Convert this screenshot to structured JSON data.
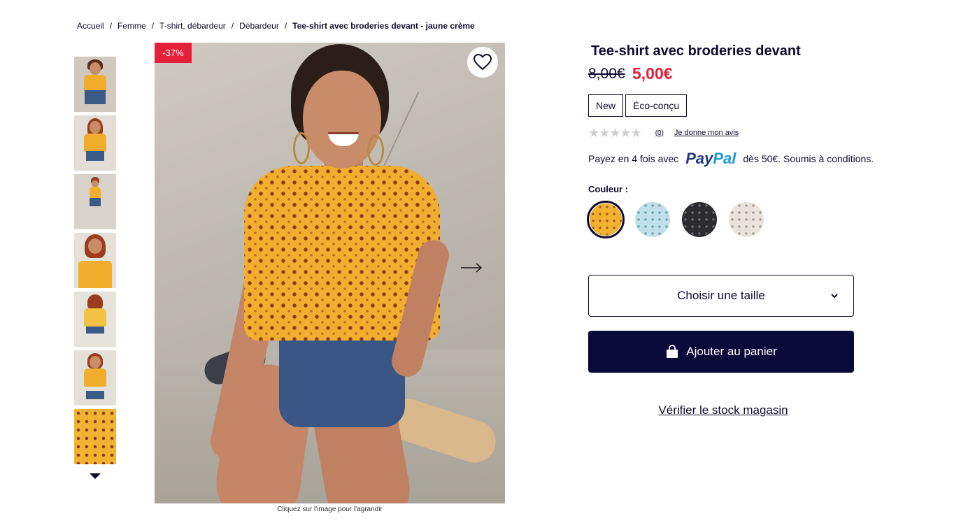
{
  "breadcrumb": {
    "items": [
      "Accueil",
      "Femme",
      "T-shirt, débardeur",
      "Débardeur"
    ],
    "separator": "/",
    "current": "Tee-shirt avec broderies devant - jaune crème"
  },
  "gallery": {
    "discount_badge": "-37%",
    "caption": "Cliquez sur l'image pour l'agrandir",
    "thumbnail_count": 7,
    "selected_thumbnail": 1
  },
  "product": {
    "title": "Tee-shirt avec broderies devant",
    "price_old": "8,00€",
    "price_new": "5,00€",
    "badges": [
      "New",
      "Éco-conçu"
    ],
    "rating": {
      "stars": "★★★★★",
      "count": "(0)",
      "review_link": "Je donne mon avis"
    },
    "paypal": {
      "prefix": "Payez en 4 fois avec",
      "logo_pay": "Pay",
      "logo_pal": "Pal",
      "suffix": "dès 50€. Soumis à conditions."
    },
    "color_label": "Couleur :",
    "colors": [
      {
        "name": "jaune",
        "hex": "#f2b22f",
        "selected": true
      },
      {
        "name": "bleu",
        "hex": "#bfe0ea",
        "selected": false
      },
      {
        "name": "noir",
        "hex": "#2b2b2e",
        "selected": false
      },
      {
        "name": "écru",
        "hex": "#e8e4dc",
        "selected": false
      }
    ],
    "size_select": "Choisir une taille",
    "add_to_cart": "Ajouter au panier",
    "stock_link": "Vérifier le stock magasin"
  },
  "colors": {
    "brand_dark": "#0a0a3a",
    "sale_red": "#e5203b",
    "text": "#0e0c2e"
  },
  "icons": [
    "heart-icon",
    "arrow-right-icon",
    "triangle-down-icon",
    "chevron-down-icon",
    "shopping-bag-icon",
    "star-icon"
  ]
}
